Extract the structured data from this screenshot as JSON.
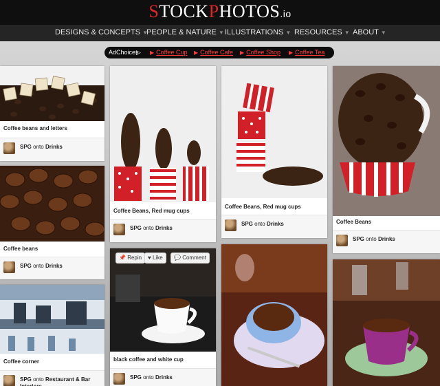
{
  "header": {
    "logo": {
      "s": "S",
      "tock": "TOCK",
      "p": "P",
      "hotos": "HOTOS",
      "io": ".io"
    }
  },
  "nav": {
    "items": [
      {
        "label": "DESIGNS & CONCEPTS"
      },
      {
        "label": "PEOPLE & NATURE"
      },
      {
        "label": "ILLUSTRATIONS"
      },
      {
        "label": "RESOURCES"
      },
      {
        "label": "ABOUT"
      }
    ]
  },
  "ads": {
    "adchoices": "AdChoices",
    "links": [
      "Coffee Cup",
      "Coffee Cafe",
      "Coffee Shop",
      "Coffee Tea"
    ]
  },
  "actions": {
    "repin": "Repin",
    "like": "Like",
    "comment": "Comment"
  },
  "pins": [
    {
      "caption": "Coffee beans and letters",
      "user": "SPG",
      "onto": "onto",
      "board": "Drinks"
    },
    {
      "caption": "Coffee beans",
      "user": "SPG",
      "onto": "onto",
      "board": "Drinks"
    },
    {
      "caption": "Coffee corner",
      "user": "SPG",
      "onto": "onto",
      "board": "Restaurant & Bar Interiors"
    },
    {
      "caption": "Coffee Beans, Red mug cups",
      "user": "SPG",
      "onto": "onto",
      "board": "Drinks"
    },
    {
      "caption": "black coffee and white cup",
      "user": "SPG",
      "onto": "onto",
      "board": "Drinks"
    },
    {
      "caption": "Coffee Beans, Red mug cups",
      "user": "SPG",
      "onto": "onto",
      "board": "Drinks"
    },
    {
      "caption": "",
      "user": "",
      "onto": "",
      "board": ""
    },
    {
      "caption": "Coffee Beans",
      "user": "SPG",
      "onto": "onto",
      "board": "Drinks"
    },
    {
      "caption": "",
      "user": "",
      "onto": "",
      "board": ""
    }
  ],
  "colors": {
    "brand_red": "#e0262c",
    "topbar": "#0f0f0f",
    "nav": "#252525",
    "ad_link": "#ff3a3a"
  },
  "icons": [
    "pin-icon",
    "heart-icon",
    "comment-icon",
    "play-icon",
    "caret-down-icon"
  ]
}
